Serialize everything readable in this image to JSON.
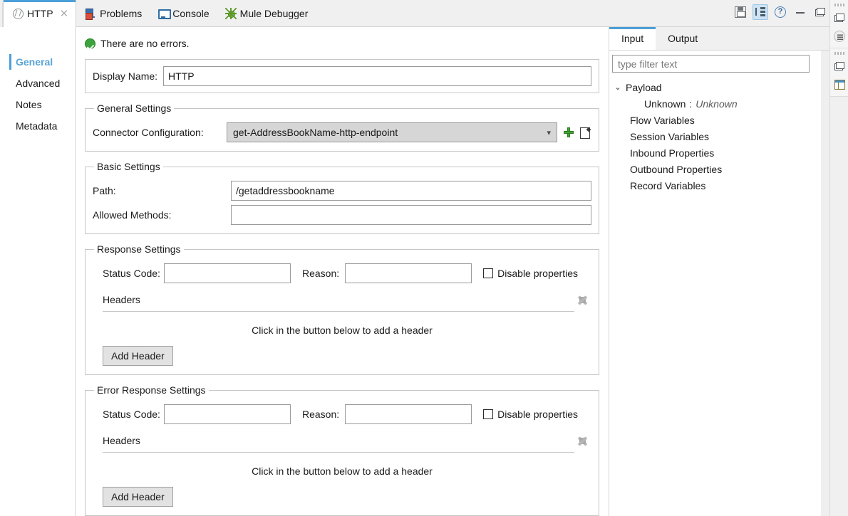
{
  "window": {
    "tabs": [
      {
        "label": "HTTP",
        "icon": "http-icon",
        "active": true,
        "closable": true
      },
      {
        "label": "Problems",
        "icon": "problems-icon",
        "active": false,
        "closable": false
      },
      {
        "label": "Console",
        "icon": "console-icon",
        "active": false,
        "closable": false
      },
      {
        "label": "Mule Debugger",
        "icon": "mule-debugger-icon",
        "active": false,
        "closable": false
      }
    ],
    "toolbar": [
      {
        "name": "save-icon",
        "title": "Save",
        "selected": false
      },
      {
        "name": "tree-view-icon",
        "title": "Tree View",
        "selected": true
      },
      {
        "name": "help-icon",
        "title": "Help",
        "glyph": "?",
        "selected": false
      },
      {
        "name": "minimize-icon",
        "title": "Minimize",
        "selected": false
      },
      {
        "name": "restore-icon",
        "title": "Restore",
        "selected": false
      }
    ],
    "rail": [
      {
        "name": "restore-icon"
      },
      {
        "name": "menu-icon"
      },
      {
        "name": "restore-icon"
      },
      {
        "name": "panel-layout-icon"
      }
    ]
  },
  "sidebar": {
    "items": [
      {
        "label": "General",
        "active": true
      },
      {
        "label": "Advanced",
        "active": false
      },
      {
        "label": "Notes",
        "active": false
      },
      {
        "label": "Metadata",
        "active": false
      }
    ]
  },
  "main": {
    "status": {
      "icon": "ok-icon",
      "text": "There are no errors."
    },
    "display_name": {
      "label": "Display Name:",
      "value": "HTTP"
    },
    "general_settings": {
      "legend": "General Settings",
      "connector_label": "Connector Configuration:",
      "connector_value": "get-AddressBookName-http-endpoint",
      "add_icon": "plus-icon",
      "edit_icon": "edit-icon"
    },
    "basic_settings": {
      "legend": "Basic Settings",
      "path_label": "Path:",
      "path_value": "/getaddressbookname",
      "methods_label": "Allowed Methods:",
      "methods_value": ""
    },
    "response_settings": {
      "legend": "Response Settings",
      "status_code_label": "Status Code:",
      "status_code_value": "",
      "reason_label": "Reason:",
      "reason_value": "",
      "disable_properties_label": "Disable properties",
      "disable_properties_checked": false,
      "headers_label": "Headers",
      "headers_delete_icon": "delete-icon",
      "hint": "Click in the button below to add a header",
      "add_header_label": "Add Header"
    },
    "error_response_settings": {
      "legend": "Error Response Settings",
      "status_code_label": "Status Code:",
      "status_code_value": "",
      "reason_label": "Reason:",
      "reason_value": "",
      "disable_properties_label": "Disable properties",
      "disable_properties_checked": false,
      "headers_label": "Headers",
      "headers_delete_icon": "delete-icon",
      "hint": "Click in the button below to add a header",
      "add_header_label": "Add Header"
    }
  },
  "right_panel": {
    "tabs": [
      {
        "label": "Input",
        "active": true
      },
      {
        "label": "Output",
        "active": false
      }
    ],
    "filter": {
      "placeholder": "type filter text",
      "value": ""
    },
    "tree": {
      "payload": {
        "label": "Payload",
        "expanded": true,
        "arrow": "⌄"
      },
      "payload_child": {
        "key": "Unknown",
        "sep": ":",
        "value": "Unknown"
      },
      "leaves": [
        "Flow Variables",
        "Session Variables",
        "Inbound Properties",
        "Outbound Properties",
        "Record Variables"
      ]
    }
  },
  "colors": {
    "accent": "#4a9fd8",
    "active_nav": "#5aa4d6",
    "ok_green": "#3da43d",
    "combo_bg": "#d6d6d6",
    "chrome_bg": "#f0f0f0"
  }
}
